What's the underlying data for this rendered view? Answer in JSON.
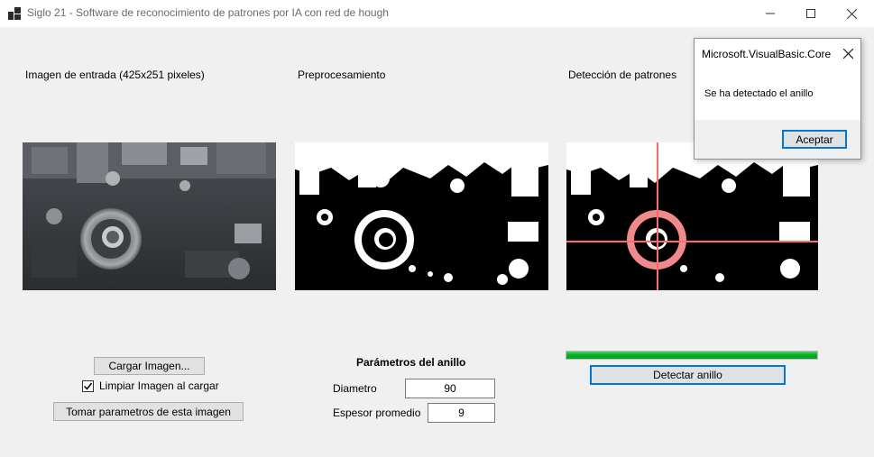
{
  "window": {
    "title": "Siglo 21 - Software de reconocimiento de patrones por IA con red de hough",
    "icons": {
      "app": "app-icon",
      "minimize": "minimize-icon",
      "maximize": "maximize-icon",
      "close": "close-icon"
    }
  },
  "sections": {
    "input_label": "Imagen de entrada (425x251 pixeles)",
    "preprocess_label": "Preprocesamiento",
    "detection_label": "Detección de patrones"
  },
  "left_controls": {
    "load_button": "Cargar Imagen...",
    "clear_checkbox_label": "Limpiar Imagen al cargar",
    "clear_checked": true,
    "take_params_button": "Tomar parametros de esta imagen"
  },
  "params": {
    "title": "Parámetros del anillo",
    "diameter_label": "Diametro",
    "diameter_value": "90",
    "thickness_label": "Espesor promedio",
    "thickness_value": "9"
  },
  "detection": {
    "progress": 1.0,
    "detect_button": "Detectar anillo"
  },
  "messagebox": {
    "title": "Microsoft.VisualBasic.Core",
    "message": "Se ha detectado el anillo",
    "ok_button": "Aceptar"
  },
  "colors": {
    "progress": "#06b025",
    "detection_overlay": "#ff6b6b",
    "focus_border": "#0078d7"
  }
}
